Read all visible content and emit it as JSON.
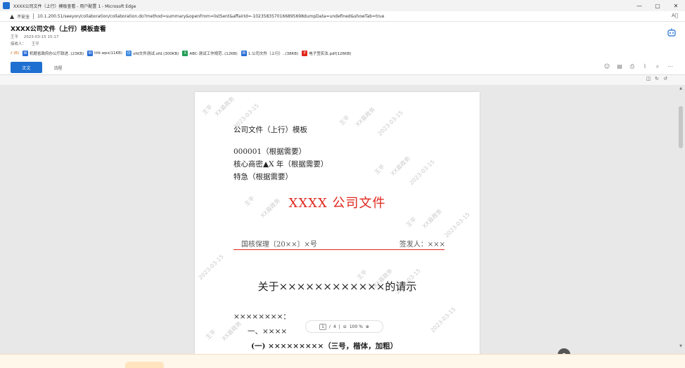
{
  "window": {
    "title": "XXXX公司文件（上行）模板查看 - 用户配置 1 - Microsoft Edge",
    "minimize": "—",
    "maximize": "▢",
    "close": "✕"
  },
  "address_bar": {
    "warning": "不安全",
    "url": "10.1.200.51/seeyon/collaboration/collaboration.do?method=summary&openFrom=listSent&affairId=-1023583570166895698dumpData=undefined&showTab=true"
  },
  "document": {
    "title": "XXXX公司文件（上行）模板查看",
    "author": "王平",
    "timestamp": "2023-03-15 15:17",
    "recipient_label": "接收人：",
    "recipient": "王平"
  },
  "attachments": {
    "count_label": "(6)",
    "items": [
      {
        "name": "机题省政府办公厅政进..(23KB)",
        "badge_color": "#2b6fd6",
        "badge": "W"
      },
      {
        "name": "tttt.wps(11KB)",
        "badge_color": "#2b6fd6",
        "badge": "W"
      },
      {
        "name": "ofd文件测试.ofd.(300KB)",
        "badge_color": "#3e8be0",
        "badge": "O"
      },
      {
        "name": "ABC-测试工作规范..(12KB)",
        "badge_color": "#1f9d55",
        "badge": "X"
      },
      {
        "name": "1.公司文件（上行）..(38KB)",
        "badge_color": "#2b6fd6",
        "badge": "W"
      },
      {
        "name": "电子签实法.pdf(126KB)",
        "badge_color": "#e0261c",
        "badge": "P"
      }
    ]
  },
  "tabs": [
    {
      "label": "正文",
      "active": true
    },
    {
      "label": "流程",
      "active": false
    }
  ],
  "page_nav": {
    "current": "1",
    "total": "4",
    "zoom": "100 %"
  },
  "doc_page": {
    "template_title": "公司文件（上行）模板",
    "serial": "000001（根据需要）",
    "secrecy": "核心商密▲X 年（根据需要）",
    "urgency": "特急（根据需要）",
    "red_head": "XXXX 公司文件",
    "doc_number": "国核保理〔20××〕×号",
    "signer": "签发人：×××",
    "subject": "关于××××××××××××的请示",
    "salutation": "××××××××：",
    "item_one": "一、××××",
    "item_one_sub": "(一) ×××××××××（三号，楷体，加粗）",
    "watermark_name": "王平",
    "watermark_date": "2023-03-15",
    "watermark_org": "XX县政务"
  }
}
